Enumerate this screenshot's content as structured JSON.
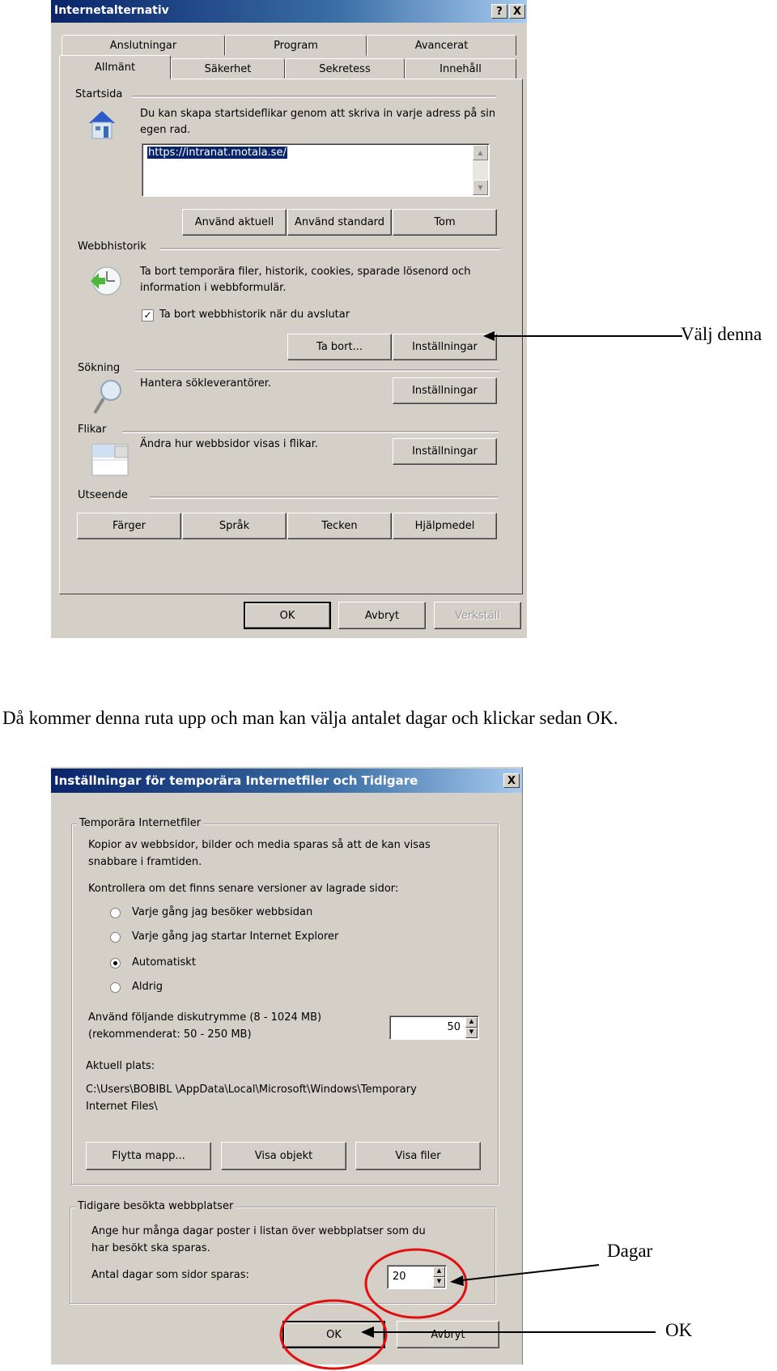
{
  "dialog1": {
    "title": "Internetalternativ",
    "help_button": "?",
    "close_button": "X",
    "tabs_row1": [
      "Anslutningar",
      "Program",
      "Avancerat"
    ],
    "tabs_row2": [
      "Allmänt",
      "Säkerhet",
      "Sekretess",
      "Innehåll"
    ],
    "active_tab": "Allmänt",
    "startsida": {
      "heading": "Startsida",
      "icon": "house-icon",
      "description": "Du kan skapa startsideflikar genom att skriva in varje adress på sin egen rad.",
      "url_value": "https://intranat.motala.se/",
      "buttons": [
        "Använd aktuell",
        "Använd standard",
        "Tom"
      ]
    },
    "webbhistorik": {
      "heading": "Webbhistorik",
      "icon": "history-clock-icon",
      "description": "Ta bort temporära filer, historik, cookies, sparade lösenord och information i webbformulär.",
      "checkbox_label": "Ta bort webbhistorik när du avslutar",
      "checkbox_checked": true,
      "buttons": [
        "Ta bort...",
        "Inställningar"
      ]
    },
    "sokning": {
      "heading": "Sökning",
      "icon": "magnifier-icon",
      "description": "Hantera sökleverantörer.",
      "button": "Inställningar"
    },
    "flikar": {
      "heading": "Flikar",
      "icon": "tabs-icon",
      "description": "Ändra hur webbsidor visas i flikar.",
      "button": "Inställningar"
    },
    "utseende": {
      "heading": "Utseende",
      "buttons": [
        "Färger",
        "Språk",
        "Tecken",
        "Hjälpmedel"
      ]
    },
    "footer": {
      "ok": "OK",
      "cancel": "Avbryt",
      "apply": "Verkställ"
    }
  },
  "annotation1": {
    "label": "Välj denna"
  },
  "paragraph": "Då kommer denna ruta upp och man kan välja antalet dagar och klickar sedan OK.",
  "dialog2": {
    "title": "Inställningar för temporära Internetfiler och Tidigare",
    "close_button": "X",
    "temp_group": {
      "heading": "Temporära Internetfiler",
      "description_line1": "Kopior av webbsidor, bilder och media sparas så att de kan visas",
      "description_line2": "snabbare i framtiden.",
      "check_label": "Kontrollera om det finns senare versioner av lagrade sidor:",
      "options": [
        {
          "label": "Varje gång jag besöker webbsidan",
          "selected": false
        },
        {
          "label": "Varje gång jag startar Internet Explorer",
          "selected": false
        },
        {
          "label": "Automatiskt",
          "selected": true
        },
        {
          "label": "Aldrig",
          "selected": false
        }
      ],
      "disk_label_line1": "Använd följande diskutrymme (8 - 1024 MB)",
      "disk_label_line2": "(rekommenderat: 50 - 250 MB)",
      "disk_value": "50",
      "location_label": "Aktuell plats:",
      "location_line1": "C:\\Users\\BOBIBL \\AppData\\Local\\Microsoft\\Windows\\Temporary",
      "location_line2": "Internet Files\\",
      "buttons": [
        "Flytta mapp...",
        "Visa objekt",
        "Visa filer"
      ]
    },
    "history_group": {
      "heading": "Tidigare besökta webbplatser",
      "description_line1": "Ange hur många dagar poster i listan över webbplatser som du",
      "description_line2": "har besökt ska sparas.",
      "days_label": "Antal dagar som sidor sparas:",
      "days_value": "20"
    },
    "footer": {
      "ok": "OK",
      "cancel": "Avbryt"
    }
  },
  "annotation_days": {
    "label": "Dagar"
  },
  "annotation_ok": {
    "label": "OK"
  },
  "colors": {
    "titlebar": "#0a246a",
    "dialog_bg": "#d4d0c8",
    "highlight": "#e01010"
  }
}
